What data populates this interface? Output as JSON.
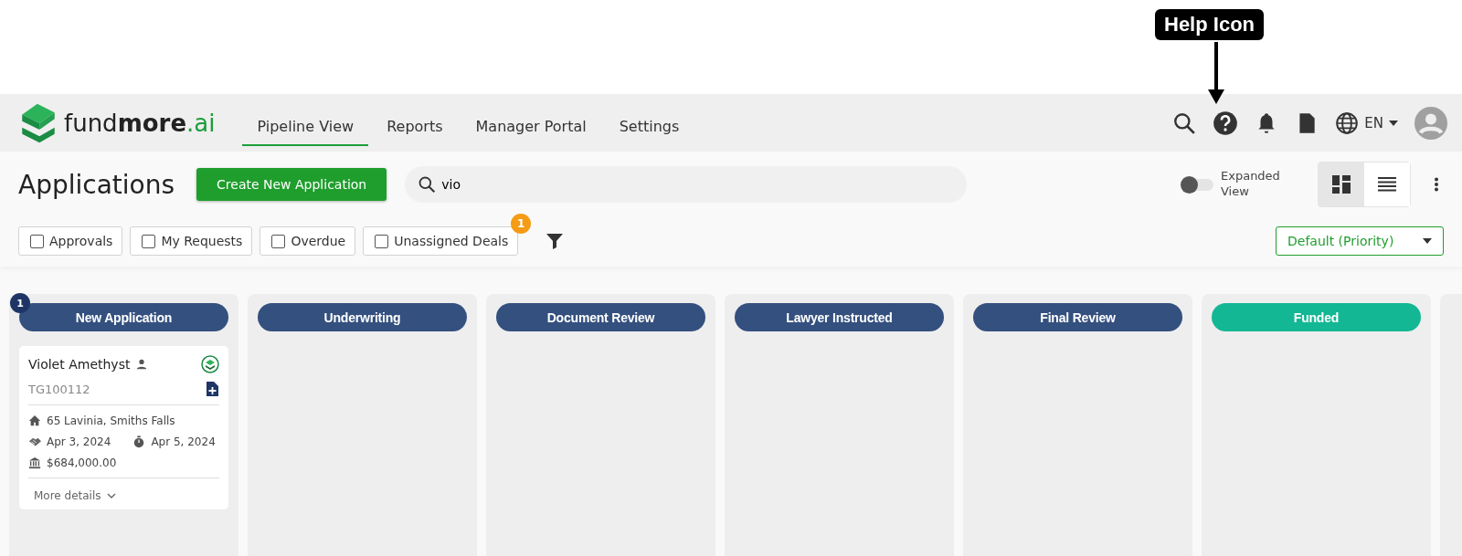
{
  "callout": {
    "text": "Help Icon"
  },
  "header": {
    "logo": {
      "part_1": "fund",
      "part_2": "more",
      "part_3": ".ai"
    },
    "nav": [
      {
        "label": "Pipeline View",
        "selected": true
      },
      {
        "label": "Reports",
        "selected": false
      },
      {
        "label": "Manager Portal",
        "selected": false
      },
      {
        "label": "Settings",
        "selected": false
      }
    ],
    "language": "EN"
  },
  "toolbar": {
    "title": "Applications",
    "create_button": "Create New Application",
    "search": {
      "value": "vio"
    },
    "expanded_view": {
      "label": "Expanded View",
      "on": false
    },
    "view_modes": [
      {
        "kind": "board",
        "selected": true
      },
      {
        "kind": "list",
        "selected": false
      }
    ],
    "filters": [
      {
        "label": "Approvals",
        "checked": false
      },
      {
        "label": "My Requests",
        "checked": false
      },
      {
        "label": "Overdue",
        "checked": false
      },
      {
        "label": "Unassigned Deals",
        "checked": false,
        "badge": "1"
      }
    ],
    "sort": "Default (Priority)"
  },
  "columns": [
    {
      "name": "New Application",
      "color": "#34507f",
      "badge": "1",
      "cards": [
        {
          "name": "Violet Amethyst",
          "id": "TG100112",
          "address": "65 Lavinia, Smiths Falls",
          "date_1": "Apr 3, 2024",
          "date_2": "Apr 5, 2024",
          "amount": "$684,000.00",
          "more": "More details"
        }
      ]
    },
    {
      "name": "Underwriting",
      "color": "#34507f"
    },
    {
      "name": "Document Review",
      "color": "#34507f"
    },
    {
      "name": "Lawyer Instructed",
      "color": "#34507f"
    },
    {
      "name": "Final Review",
      "color": "#34507f"
    },
    {
      "name": "Funded",
      "color": "#13b793"
    }
  ]
}
